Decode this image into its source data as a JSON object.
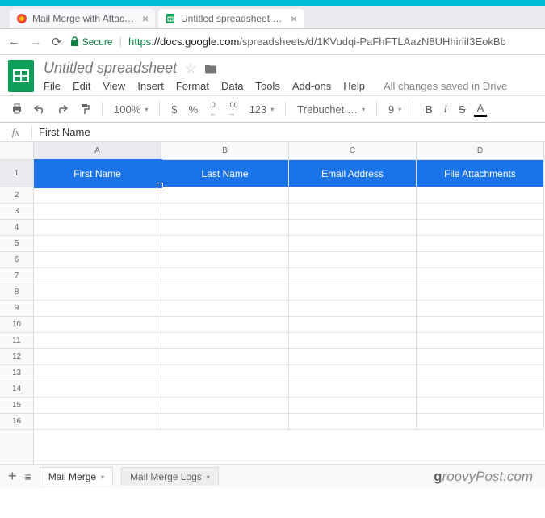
{
  "browser": {
    "tabs": [
      {
        "title": "Mail Merge with Attachm",
        "active": false
      },
      {
        "title": "Untitled spreadsheet - G",
        "active": true
      }
    ],
    "secure_label": "Secure",
    "url_https": "https",
    "url_host": "://docs.google.com",
    "url_path": "/spreadsheets/d/1KVudqi-PaFhFTLAazN8UHhiriiI3EokBb"
  },
  "doc": {
    "title": "Untitled spreadsheet",
    "menu": [
      "File",
      "Edit",
      "View",
      "Insert",
      "Format",
      "Data",
      "Tools",
      "Add-ons",
      "Help"
    ],
    "save_status": "All changes saved in Drive"
  },
  "toolbar": {
    "zoom": "100%",
    "currency": "$",
    "percent": "%",
    "dec_dec": ".0",
    "dec_inc": ".00",
    "more_formats": "123",
    "font": "Trebuchet …",
    "font_size": "9",
    "bold": "B",
    "italic": "I",
    "strike": "S",
    "color": "A"
  },
  "formula": {
    "fx": "fx",
    "value": "First Name"
  },
  "grid": {
    "columns": [
      "A",
      "B",
      "C",
      "D"
    ],
    "row_numbers": [
      "1",
      "2",
      "3",
      "4",
      "5",
      "6",
      "7",
      "8",
      "9",
      "10",
      "11",
      "12",
      "13",
      "14",
      "15",
      "16"
    ],
    "headers": [
      "First Name",
      "Last Name",
      "Email Address",
      "File Attachments"
    ],
    "active_cell": "A1"
  },
  "sheets": {
    "tabs": [
      {
        "label": "Mail Merge",
        "active": true
      },
      {
        "label": "Mail Merge Logs",
        "active": false
      }
    ]
  },
  "watermark": {
    "g": "g",
    "rest": "roovyPost.com"
  }
}
